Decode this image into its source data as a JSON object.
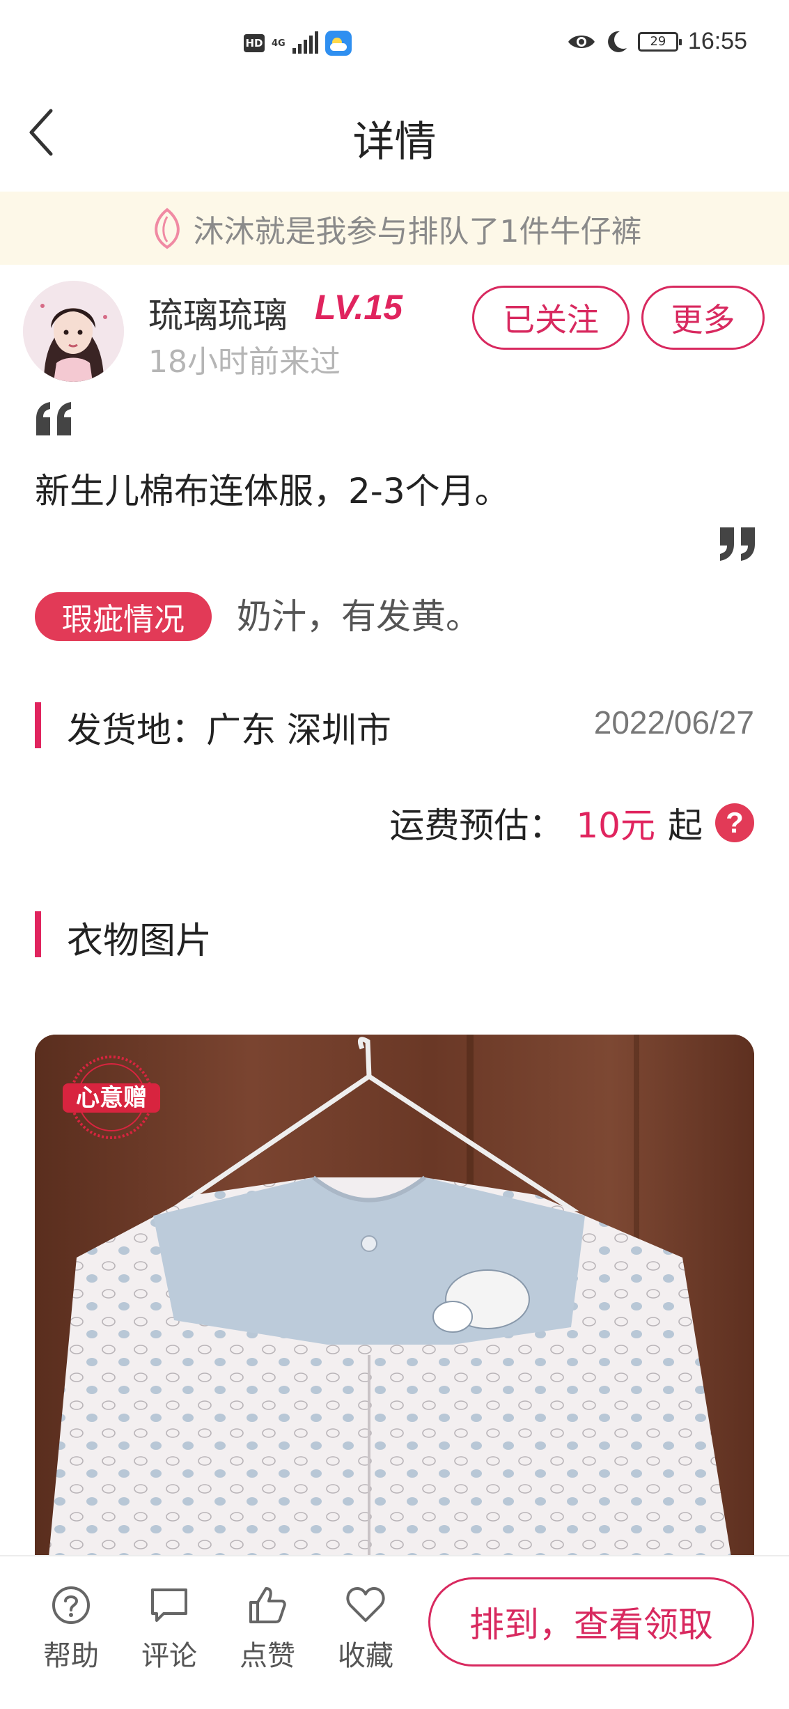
{
  "status_bar": {
    "hd": "HD",
    "network": "4G",
    "battery": "29",
    "time": "16:55"
  },
  "header": {
    "title": "详情"
  },
  "notice": {
    "text": "沐沐就是我参与排队了1件牛仔裤"
  },
  "user": {
    "name": "琉璃琉璃",
    "level": "LV.15",
    "last_seen": "18小时前来过",
    "follow_label": "已关注",
    "more_label": "更多"
  },
  "item": {
    "description": "新生儿棉布连体服，2-3个月。",
    "defect_label": "瑕疵情况",
    "defect_text": "奶汁，有发黄。",
    "ship_from": "发货地：广东 深圳市",
    "date": "2022/06/27",
    "fee_label": "运费预估：",
    "fee_amount": "10元",
    "fee_suffix": "起",
    "fee_help": "?",
    "photos_title": "衣物图片",
    "photo_stamp": "心意赠"
  },
  "bottom_bar": {
    "help_label": "帮助",
    "comment_label": "评论",
    "like_label": "点赞",
    "favorite_label": "收藏",
    "claim_label": "排到，查看领取"
  },
  "colors": {
    "accent": "#e0245e",
    "badge": "#e23a57",
    "notice_bg": "#fdf8e8"
  }
}
